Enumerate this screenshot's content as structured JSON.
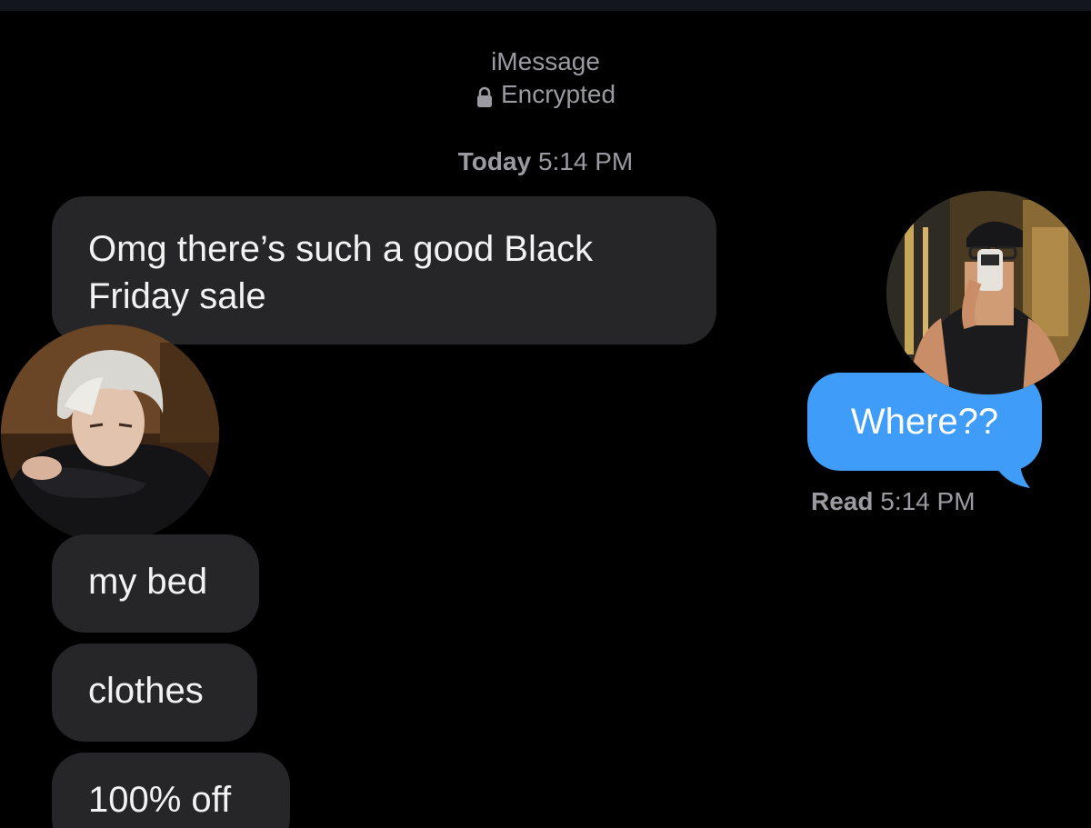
{
  "header": {
    "service": "iMessage",
    "encryption": "Encrypted",
    "lock_icon": "lock-icon"
  },
  "timestamp": {
    "day": "Today",
    "time": "5:14 PM"
  },
  "messages": [
    {
      "direction": "received",
      "text": "Omg there’s such a good Black Friday sale"
    },
    {
      "direction": "sent",
      "text": "Where??"
    },
    {
      "direction": "received",
      "text": "my bed"
    },
    {
      "direction": "received",
      "text": "clothes"
    },
    {
      "direction": "received",
      "text": "100% off"
    }
  ],
  "read_receipt": {
    "label": "Read",
    "time": "5:14 PM"
  },
  "colors": {
    "background": "#000000",
    "received_bubble": "#262629",
    "sent_bubble": "#3f9cf8",
    "meta_text": "#9a9aa0"
  }
}
